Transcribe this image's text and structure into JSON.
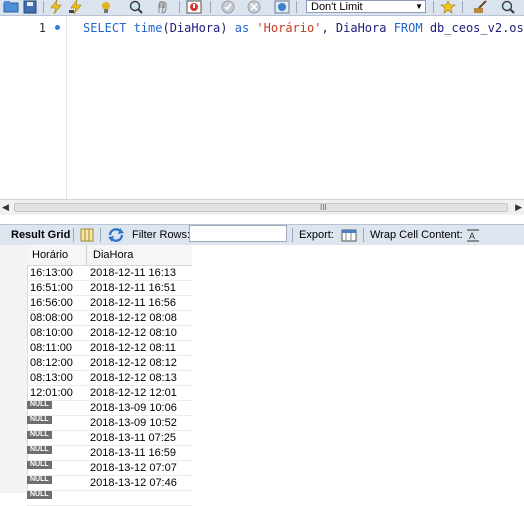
{
  "toolbar": {
    "icons": [
      "folder-icon",
      "save-icon",
      "lightning-execute-icon",
      "lightning-cursor-icon",
      "magnifier-explain-icon",
      "stop-icon",
      "toggle-error-icon",
      "commit-icon",
      "rollback-icon",
      "autocommit-icon",
      "add-snippet-icon",
      "beautify-icon",
      "find-icon"
    ],
    "limit_label": "Don't Limit"
  },
  "editor": {
    "line_number": "1",
    "sql_tokens": [
      {
        "text": "SELECT ",
        "type": "kw"
      },
      {
        "text": "time",
        "type": "kw"
      },
      {
        "text": "(DiaHora) ",
        "type": "plain"
      },
      {
        "text": "as ",
        "type": "kw"
      },
      {
        "text": "'Horário'",
        "type": "str"
      },
      {
        "text": ", DiaHora ",
        "type": "plain"
      },
      {
        "text": "FROM ",
        "type": "kw"
      },
      {
        "text": "db_ceos_v2.os;",
        "type": "plain"
      }
    ]
  },
  "scroll": {
    "grip": "III"
  },
  "result_bar": {
    "result_grid_label": "Result Grid",
    "filter_rows_label": "Filter Rows:",
    "filter_value": "",
    "export_label": "Export:",
    "wrap_label": "Wrap Cell Content:"
  },
  "grid": {
    "columns": [
      "Horário",
      "DiaHora"
    ],
    "null_label": "NULL",
    "rows": [
      [
        "16:13:00",
        "2018-12-11 16:13"
      ],
      [
        "16:51:00",
        "2018-12-11 16:51"
      ],
      [
        "16:56:00",
        "2018-12-11 16:56"
      ],
      [
        "08:08:00",
        "2018-12-12 08:08"
      ],
      [
        "08:10:00",
        "2018-12-12 08:10"
      ],
      [
        "08:11:00",
        "2018-12-12 08:11"
      ],
      [
        "08:12:00",
        "2018-12-12 08:12"
      ],
      [
        "08:13:00",
        "2018-12-12 08:13"
      ],
      [
        "12:01:00",
        "2018-12-12 12:01"
      ],
      [
        null,
        "2018-13-09 10:06"
      ],
      [
        null,
        "2018-13-09 10:52"
      ],
      [
        null,
        "2018-13-11 07:25"
      ],
      [
        null,
        "2018-13-11 16:59"
      ],
      [
        null,
        "2018-13-12 07:07"
      ],
      [
        null,
        "2018-13-12 07:46"
      ],
      [
        null,
        ""
      ]
    ]
  }
}
